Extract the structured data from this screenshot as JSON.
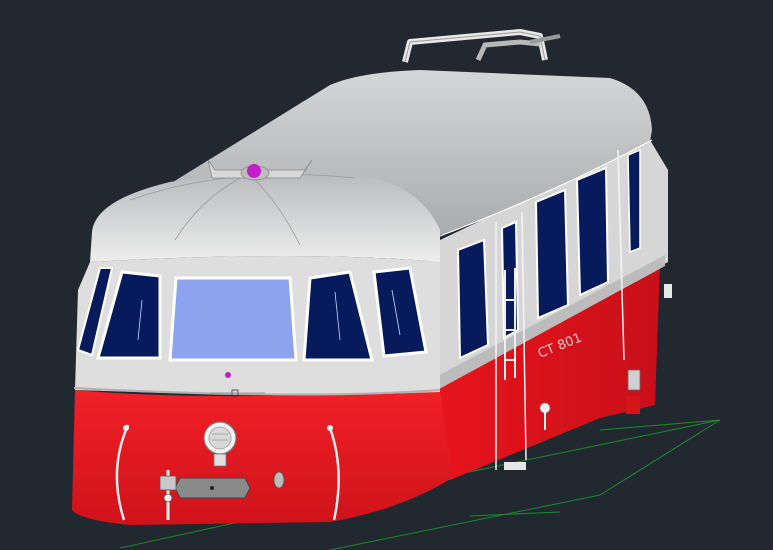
{
  "viewport": {
    "background": "#212830",
    "grid_color": "#1f8a2e"
  },
  "railcar": {
    "colors": {
      "roof": "#c2c4c6",
      "upper_body": "#dcdcdc",
      "lower_body": "#e8141c",
      "lower_shadow": "#b50e14",
      "window_dark": "#061a5c",
      "window_front": "#8da3ee",
      "trim": "#f2f2f2",
      "horn_marker": "#c41ec8"
    },
    "number_plate": "CT 801"
  }
}
